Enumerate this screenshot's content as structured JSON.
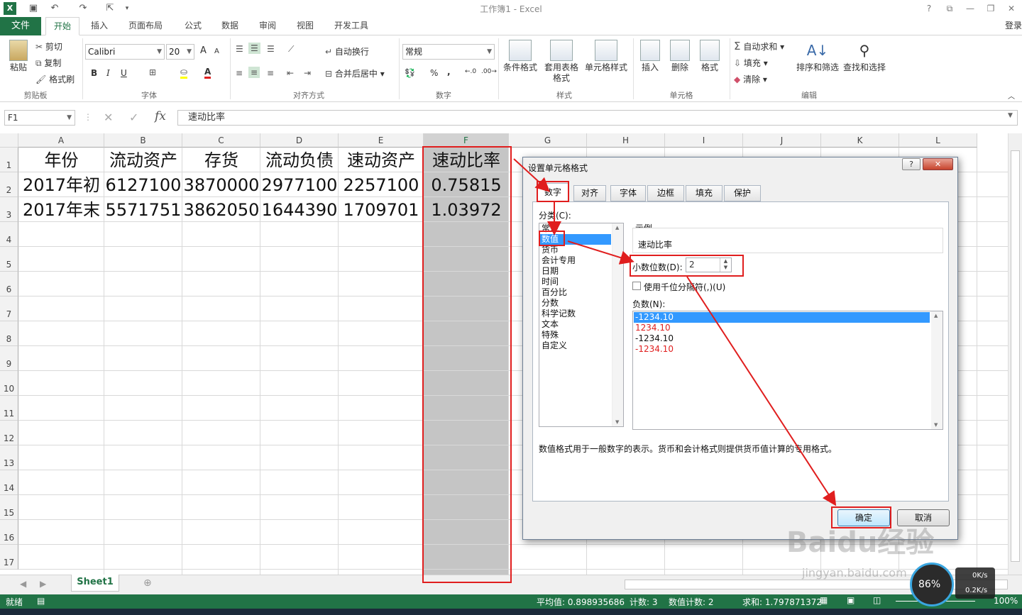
{
  "window": {
    "title": "工作簿1 - Excel",
    "help": "?",
    "login": "登录"
  },
  "ribbon_tabs": [
    "文件",
    "开始",
    "插入",
    "页面布局",
    "公式",
    "数据",
    "审阅",
    "视图",
    "开发工具"
  ],
  "clipboard": {
    "paste": "粘贴",
    "cut": "剪切",
    "copy": "复制",
    "painter": "格式刷",
    "group": "剪贴板"
  },
  "font": {
    "name": "Calibri",
    "size": "20",
    "bold": "B",
    "italic": "I",
    "underline": "U",
    "group": "字体",
    "font_color_glyph": "A",
    "grow_glyph": "A",
    "shrink_glyph": "A"
  },
  "alignment": {
    "wrap": "自动换行",
    "merge": "合并后居中",
    "group": "对齐方式"
  },
  "number": {
    "format": "常规",
    "percent": "%",
    "comma": ",",
    "group": "数字"
  },
  "styles": {
    "conditional": "条件格式",
    "table": "套用表格格式",
    "cell_styles": "单元格样式",
    "group": "样式"
  },
  "cells": {
    "insert": "插入",
    "delete": "删除",
    "format": "格式",
    "group": "单元格"
  },
  "editing": {
    "autosum": "自动求和",
    "fill": "填充",
    "clear": "清除",
    "sort": "排序和筛选",
    "find": "查找和选择",
    "group": "编辑"
  },
  "formula_bar": {
    "name_box": "F1",
    "fx": "fx",
    "content": "速动比率"
  },
  "columns": [
    "A",
    "B",
    "C",
    "D",
    "E",
    "F",
    "G",
    "H",
    "I",
    "J",
    "K",
    "L"
  ],
  "rows": [
    "1",
    "2",
    "3",
    "4",
    "5",
    "6",
    "7",
    "8",
    "9",
    "10",
    "11",
    "12",
    "13",
    "14",
    "15",
    "16",
    "17"
  ],
  "table": {
    "header": [
      "年份",
      "流动资产",
      "存货",
      "流动负债",
      "速动资产",
      "速动比率"
    ],
    "rows": [
      [
        "2017年初",
        "6127100",
        "3870000",
        "2977100",
        "2257100",
        "0.75815"
      ],
      [
        "2017年末",
        "5571751",
        "3862050",
        "1644390",
        "1709701",
        "1.03972"
      ]
    ]
  },
  "dialog": {
    "title": "设置单元格格式",
    "help": "?",
    "tabs": [
      "数字",
      "对齐",
      "字体",
      "边框",
      "填充",
      "保护"
    ],
    "category_label": "分类(C):",
    "categories": [
      "常规",
      "数值",
      "货币",
      "会计专用",
      "日期",
      "时间",
      "百分比",
      "分数",
      "科学记数",
      "文本",
      "特殊",
      "自定义"
    ],
    "selected_category": "数值",
    "sample_label": "示例",
    "sample_value": "速动比率",
    "decimal_label": "小数位数(D):",
    "decimal_value": "2",
    "thousands_label": "使用千位分隔符(,)(U)",
    "negative_label": "负数(N):",
    "negative_options": [
      "-1234.10",
      "1234.10",
      "-1234.10",
      "-1234.10"
    ],
    "description": "数值格式用于一般数字的表示。货币和会计格式则提供货币值计算的专用格式。",
    "ok": "确定",
    "cancel": "取消"
  },
  "sheet": {
    "tab": "Sheet1"
  },
  "status": {
    "ready": "就绪",
    "average": "平均值: 0.898935686",
    "count": "计数: 3",
    "numeric_count": "数值计数: 2",
    "sum": "求和: 1.797871372",
    "zoom": "100%"
  },
  "overlay": {
    "speed_percent": "86%",
    "up": "0K/s",
    "down": "0.2K/s",
    "watermark": "Baidu经验",
    "watermark_url": "jingyan.baidu.com"
  },
  "colors": {
    "excel_green": "#217346",
    "annotation_red": "#e01e1e",
    "selection_blue": "#3399ff",
    "negative_red": "#e02020"
  }
}
